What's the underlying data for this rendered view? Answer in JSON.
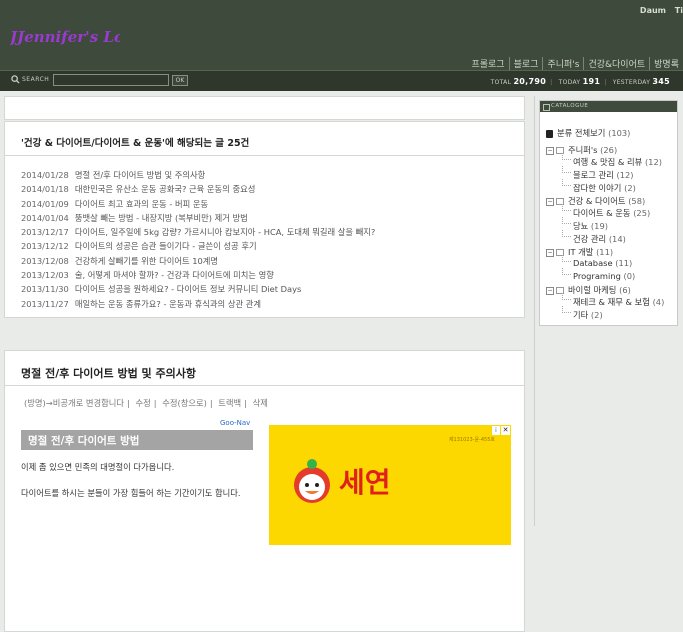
{
  "header": {
    "links": [
      "Daum",
      "Ti"
    ],
    "logo_text": "JJennifer's Logs",
    "nav": [
      "프롤로그",
      "블로그",
      "주니퍼's",
      "건강&다이어트",
      "방명록"
    ]
  },
  "searchbar": {
    "label": "SEARCH",
    "input_value": "",
    "ok_label": "OK",
    "stats": {
      "total_label": "TOTAL",
      "total": "20,790",
      "today_label": "TODAY",
      "today": "191",
      "yesterday_label": "YESTERDAY",
      "yesterday": "345"
    }
  },
  "list_panel": {
    "title": "'건강 & 다이어트/다이어트 & 운동'에 해당되는 글 25건",
    "posts": [
      {
        "date": "2014/01/28",
        "title": "명절 전/후 다이어트 방법 및 주의사항"
      },
      {
        "date": "2014/01/18",
        "title": "대한민국은 유산소 운동 공화국? 근육 운동의 중요성"
      },
      {
        "date": "2014/01/09",
        "title": "다이어트 최고 효과의 운동 - 버피 운동"
      },
      {
        "date": "2014/01/04",
        "title": "뚱뱃살 빼는 방법 - 내장지방 (복부비만) 제거 방법"
      },
      {
        "date": "2013/12/17",
        "title": "다이어트, 일주일에 5kg 감량? 가르시니아 캄보지아 - HCA, 도대체 뭐길래 살을 빼지?"
      },
      {
        "date": "2013/12/12",
        "title": "다이어트의 성공은 습관 들이기다 - 글쓴이 성공 후기"
      },
      {
        "date": "2013/12/08",
        "title": "건강하게 살빼기를 위한 다이어트 10계명"
      },
      {
        "date": "2013/12/03",
        "title": "술, 어떻게 마셔야 할까? - 건강과 다이어트에 미치는 영향"
      },
      {
        "date": "2013/11/30",
        "title": "다이어트 성공을 원하세요? - 다이어트 정보 커뮤니티 Diet Days"
      },
      {
        "date": "2013/11/27",
        "title": "매일하는 운동 종류가요? - 운동과 휴식과의 상관 관계"
      }
    ]
  },
  "post": {
    "title": "명절 전/후 다이어트 방법 및 주의사항",
    "actions": [
      "(방명)→비공개로 변경합니다",
      "수정",
      "수정(창으로)",
      "트랙백",
      "삭제"
    ],
    "goonav": "Goo-Nav",
    "subheading": "명절 전/후 다이어트 방법",
    "para1": "이제 좀 있으면 민족의 대명절이 다가옵니다.",
    "para2": "다이어트를 하시는 분들이 가장 힘들어 하는 기간이기도 합니다.",
    "ad": {
      "brand": "세연",
      "tiny": "제131023-윤-455호"
    }
  },
  "sidebar": {
    "heading": "CATALOGUE",
    "all": {
      "label": "분류 전체보기",
      "count": "(103)"
    },
    "groups": [
      {
        "label": "주니퍼's",
        "count": "(26)",
        "children": [
          {
            "label": "여행 & 맛집 & 리뷰",
            "count": "(12)"
          },
          {
            "label": "블로그 관리",
            "count": "(12)"
          },
          {
            "label": "잡다한 이야기",
            "count": "(2)"
          }
        ]
      },
      {
        "label": "건강 & 다이어트",
        "count": "(58)",
        "children": [
          {
            "label": "다이어트 & 운동",
            "count": "(25)"
          },
          {
            "label": "당뇨",
            "count": "(19)"
          },
          {
            "label": "건강 관리",
            "count": "(14)"
          }
        ]
      },
      {
        "label": "IT 개발",
        "count": "(11)",
        "children": [
          {
            "label": "Database",
            "count": "(11)"
          },
          {
            "label": "Programing",
            "count": "(0)"
          }
        ]
      },
      {
        "label": "바이럴 마케팅",
        "count": "(6)",
        "children": [
          {
            "label": "재테크 & 재무 & 보험",
            "count": "(4)"
          },
          {
            "label": "기타",
            "count": "(2)"
          }
        ]
      }
    ]
  }
}
